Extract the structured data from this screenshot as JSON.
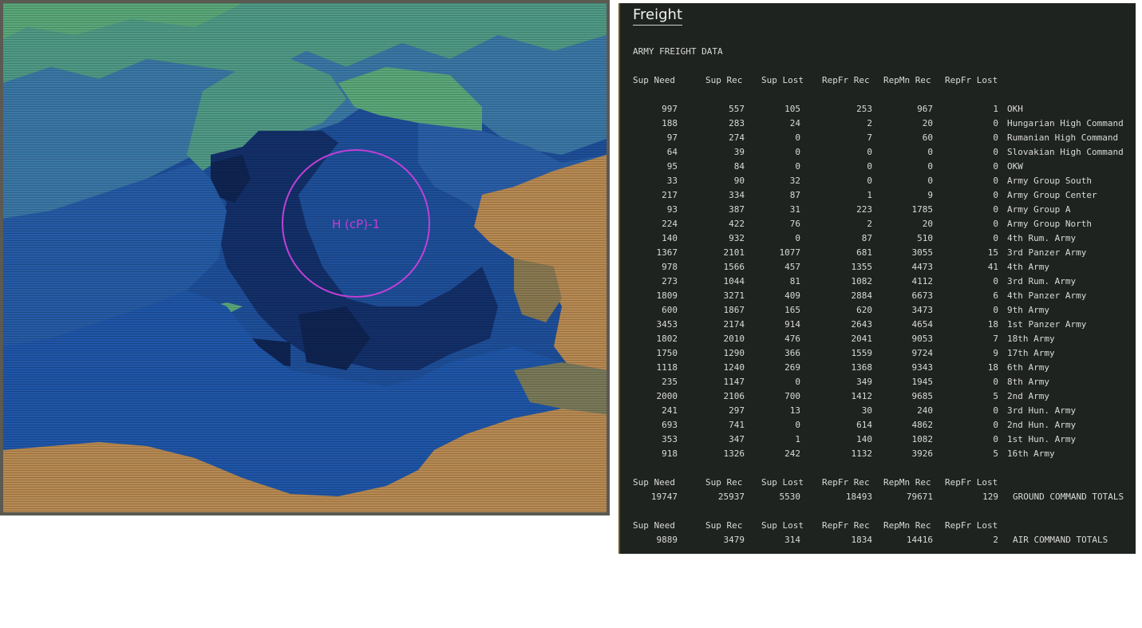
{
  "map": {
    "marker_label": "H (cP)-1",
    "colors": {
      "marker": "#c040d8",
      "polar": "#4f9a86",
      "cold_sea": "#3a78a6",
      "deep_blue": "#1e4f9a",
      "dark_blue": "#13306a",
      "darkest": "#0f2452",
      "land_tan": "#b88a52",
      "land_light": "#7a7a5a",
      "light_green": "#5aa87a"
    }
  },
  "freight": {
    "title": "Freight",
    "section_label": "ARMY FREIGHT DATA",
    "columns": [
      "Sup Need",
      "Sup Rec",
      "Sup Lost",
      "RepFr Rec",
      "RepMn Rec",
      "RepFr Lost"
    ],
    "rows": [
      {
        "sup_need": "997",
        "sup_rec": "557",
        "sup_lost": "105",
        "repfr_rec": "253",
        "repmn_rec": "967",
        "repfr_lost": "1",
        "name": "OKH"
      },
      {
        "sup_need": "188",
        "sup_rec": "283",
        "sup_lost": "24",
        "repfr_rec": "2",
        "repmn_rec": "20",
        "repfr_lost": "0",
        "name": "Hungarian High Command"
      },
      {
        "sup_need": "97",
        "sup_rec": "274",
        "sup_lost": "0",
        "repfr_rec": "7",
        "repmn_rec": "60",
        "repfr_lost": "0",
        "name": "Rumanian High Command"
      },
      {
        "sup_need": "64",
        "sup_rec": "39",
        "sup_lost": "0",
        "repfr_rec": "0",
        "repmn_rec": "0",
        "repfr_lost": "0",
        "name": "Slovakian High Command"
      },
      {
        "sup_need": "95",
        "sup_rec": "84",
        "sup_lost": "0",
        "repfr_rec": "0",
        "repmn_rec": "0",
        "repfr_lost": "0",
        "name": "OKW"
      },
      {
        "sup_need": "33",
        "sup_rec": "90",
        "sup_lost": "32",
        "repfr_rec": "0",
        "repmn_rec": "0",
        "repfr_lost": "0",
        "name": "Army Group South"
      },
      {
        "sup_need": "217",
        "sup_rec": "334",
        "sup_lost": "87",
        "repfr_rec": "1",
        "repmn_rec": "9",
        "repfr_lost": "0",
        "name": "Army Group Center"
      },
      {
        "sup_need": "93",
        "sup_rec": "387",
        "sup_lost": "31",
        "repfr_rec": "223",
        "repmn_rec": "1785",
        "repfr_lost": "0",
        "name": "Army Group A"
      },
      {
        "sup_need": "224",
        "sup_rec": "422",
        "sup_lost": "76",
        "repfr_rec": "2",
        "repmn_rec": "20",
        "repfr_lost": "0",
        "name": "Army Group North"
      },
      {
        "sup_need": "140",
        "sup_rec": "932",
        "sup_lost": "0",
        "repfr_rec": "87",
        "repmn_rec": "510",
        "repfr_lost": "0",
        "name": "4th Rum. Army"
      },
      {
        "sup_need": "1367",
        "sup_rec": "2101",
        "sup_lost": "1077",
        "repfr_rec": "681",
        "repmn_rec": "3055",
        "repfr_lost": "15",
        "name": "3rd Panzer Army"
      },
      {
        "sup_need": "978",
        "sup_rec": "1566",
        "sup_lost": "457",
        "repfr_rec": "1355",
        "repmn_rec": "4473",
        "repfr_lost": "41",
        "name": "4th Army"
      },
      {
        "sup_need": "273",
        "sup_rec": "1044",
        "sup_lost": "81",
        "repfr_rec": "1082",
        "repmn_rec": "4112",
        "repfr_lost": "0",
        "name": "3rd Rum. Army"
      },
      {
        "sup_need": "1809",
        "sup_rec": "3271",
        "sup_lost": "409",
        "repfr_rec": "2884",
        "repmn_rec": "6673",
        "repfr_lost": "6",
        "name": "4th Panzer Army"
      },
      {
        "sup_need": "600",
        "sup_rec": "1867",
        "sup_lost": "165",
        "repfr_rec": "620",
        "repmn_rec": "3473",
        "repfr_lost": "0",
        "name": "9th Army"
      },
      {
        "sup_need": "3453",
        "sup_rec": "2174",
        "sup_lost": "914",
        "repfr_rec": "2643",
        "repmn_rec": "4654",
        "repfr_lost": "18",
        "name": "1st Panzer Army"
      },
      {
        "sup_need": "1802",
        "sup_rec": "2010",
        "sup_lost": "476",
        "repfr_rec": "2041",
        "repmn_rec": "9053",
        "repfr_lost": "7",
        "name": "18th Army"
      },
      {
        "sup_need": "1750",
        "sup_rec": "1290",
        "sup_lost": "366",
        "repfr_rec": "1559",
        "repmn_rec": "9724",
        "repfr_lost": "9",
        "name": "17th Army"
      },
      {
        "sup_need": "1118",
        "sup_rec": "1240",
        "sup_lost": "269",
        "repfr_rec": "1368",
        "repmn_rec": "9343",
        "repfr_lost": "18",
        "name": "6th Army"
      },
      {
        "sup_need": "235",
        "sup_rec": "1147",
        "sup_lost": "0",
        "repfr_rec": "349",
        "repmn_rec": "1945",
        "repfr_lost": "0",
        "name": "8th Army"
      },
      {
        "sup_need": "2000",
        "sup_rec": "2106",
        "sup_lost": "700",
        "repfr_rec": "1412",
        "repmn_rec": "9685",
        "repfr_lost": "5",
        "name": "2nd Army"
      },
      {
        "sup_need": "241",
        "sup_rec": "297",
        "sup_lost": "13",
        "repfr_rec": "30",
        "repmn_rec": "240",
        "repfr_lost": "0",
        "name": "3rd Hun. Army"
      },
      {
        "sup_need": "693",
        "sup_rec": "741",
        "sup_lost": "0",
        "repfr_rec": "614",
        "repmn_rec": "4862",
        "repfr_lost": "0",
        "name": "2nd Hun. Army"
      },
      {
        "sup_need": "353",
        "sup_rec": "347",
        "sup_lost": "1",
        "repfr_rec": "140",
        "repmn_rec": "1082",
        "repfr_lost": "0",
        "name": "1st Hun. Army"
      },
      {
        "sup_need": "918",
        "sup_rec": "1326",
        "sup_lost": "242",
        "repfr_rec": "1132",
        "repmn_rec": "3926",
        "repfr_lost": "5",
        "name": "16th Army"
      }
    ],
    "ground_totals": {
      "sup_need": "19747",
      "sup_rec": "25937",
      "sup_lost": "5530",
      "repfr_rec": "18493",
      "repmn_rec": "79671",
      "repfr_lost": "129",
      "name": "GROUND COMMAND TOTALS"
    },
    "air_totals": {
      "sup_need": "9889",
      "sup_rec": "3479",
      "sup_lost": "314",
      "repfr_rec": "1834",
      "repmn_rec": "14416",
      "repfr_lost": "2",
      "name": "AIR COMMAND TOTALS"
    }
  }
}
